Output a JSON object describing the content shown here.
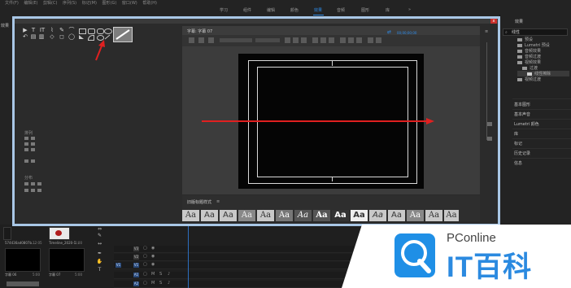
{
  "menubar": [
    "文件(F)",
    "编辑(E)",
    "剪辑(C)",
    "序列(S)",
    "标记(M)",
    "图形(G)",
    "窗口(W)",
    "帮助(H)"
  ],
  "workspace_tabs": [
    {
      "label": "学习",
      "active": false
    },
    {
      "label": "组件",
      "active": false
    },
    {
      "label": "编辑",
      "active": false
    },
    {
      "label": "颜色",
      "active": false
    },
    {
      "label": "效果",
      "active": true
    },
    {
      "label": "音频",
      "active": false
    },
    {
      "label": "图形",
      "active": false
    },
    {
      "label": "库",
      "active": false
    }
  ],
  "workspace_more": "»",
  "left_panel_header": "效果",
  "effects_panel": {
    "title": "效果",
    "search_value": "线性",
    "tree": [
      {
        "label": "预设",
        "indent": 0,
        "selected": false
      },
      {
        "label": "Lumetri 预设",
        "indent": 0,
        "selected": false
      },
      {
        "label": "音频效果",
        "indent": 0,
        "selected": false
      },
      {
        "label": "音频过渡",
        "indent": 0,
        "selected": false
      },
      {
        "label": "视频效果",
        "indent": 0,
        "selected": false
      },
      {
        "label": "过渡",
        "indent": 1,
        "selected": false
      },
      {
        "label": "线性擦除",
        "indent": 2,
        "selected": true
      },
      {
        "label": "视频过渡",
        "indent": 0,
        "selected": false
      }
    ],
    "sections": [
      "基本图形",
      "基本声音",
      "Lumetri 颜色",
      "库",
      "标记",
      "历史记录",
      "信息"
    ]
  },
  "dialog": {
    "title_text": "字幕: 字幕 07",
    "close_glyph": "x",
    "timecode": "00;00;00;00",
    "tools": [
      "▶",
      "T",
      "IT",
      "⌇",
      "✎",
      "⌒",
      "↶",
      "▤",
      "▥",
      "◇",
      "◻",
      "◯"
    ],
    "section_left_1": "排列",
    "section_left_2": "分布",
    "styles_header": "旧版标题样式",
    "style_samples": [
      "Aa",
      "Aa",
      "Aa",
      "Aa",
      "Aa",
      "Aa",
      "Aa",
      "Aa",
      "Aa",
      "Aa",
      "Aa",
      "Aa",
      "Aa",
      "Aa",
      "Aa"
    ]
  },
  "project_items": [
    {
      "name": "574436ad0807b...",
      "dur": "12:05"
    },
    {
      "name": "Timeline_2020-1...",
      "dur": "1:00"
    },
    {
      "name": "字幕 06",
      "dur": "5:00"
    },
    {
      "name": "字幕 07",
      "dur": "5:00"
    }
  ],
  "timeline_tracks": [
    "V3",
    "V2",
    "V1",
    "A1",
    "A2"
  ],
  "logo": {
    "brand_top": "PConline",
    "brand_main": "IT百科",
    "accent_color": "#1f8fe6"
  },
  "annotations": {
    "arrow_color": "#e02020"
  }
}
